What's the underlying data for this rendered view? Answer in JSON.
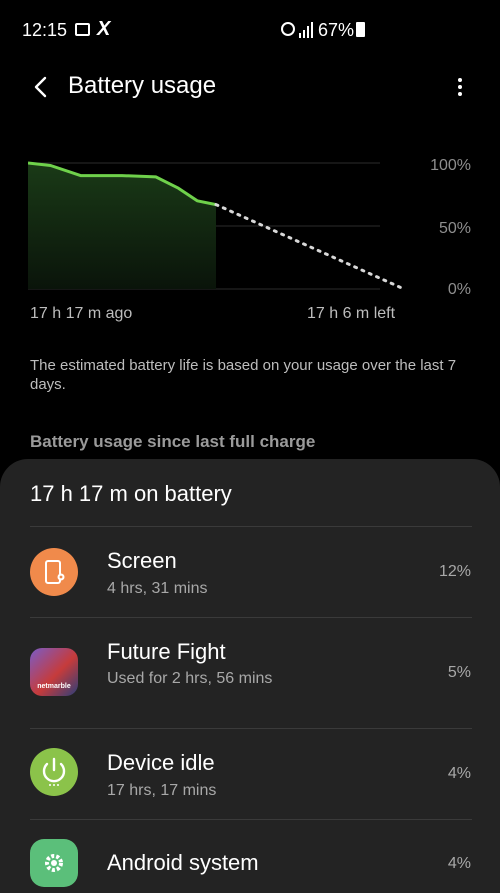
{
  "status_bar": {
    "time": "12:15",
    "battery_percent": "67%",
    "icons": [
      "gallery-icon",
      "x-app-icon",
      "alarm-icon",
      "signal-icon",
      "battery-icon"
    ]
  },
  "header": {
    "title": "Battery usage",
    "back_icon": "back-arrow-icon",
    "more_icon": "more-options-icon"
  },
  "chart": {
    "y_ticks": [
      "100%",
      "50%",
      "0%"
    ],
    "x_start_label": "17 h 17 m ago",
    "x_end_label": "17 h 6 m left"
  },
  "chart_data": {
    "type": "line",
    "ylim": [
      0,
      100
    ],
    "series": [
      {
        "x": [
          0,
          0.06,
          0.14,
          0.25,
          0.34,
          0.4,
          0.45,
          0.5
        ],
        "y": [
          100,
          98,
          90,
          90,
          89,
          80,
          70,
          67
        ]
      },
      {
        "x": [
          0.5,
          1.0
        ],
        "y": [
          67,
          0
        ]
      }
    ],
    "colors": {
      "actual": "#6fd14b",
      "projected": "#d8d8d8",
      "fill": "#1a3a17"
    }
  },
  "estimate_note": "The estimated battery life is based on your usage over the last 7 days.",
  "section_heading": "Battery usage since last full charge",
  "usage": {
    "on_battery": "17 h 17 m on battery",
    "items": [
      {
        "name": "Screen",
        "detail": "4 hrs, 31 mins",
        "percent": "12%",
        "icon": "screen-settings-icon",
        "color": "#f08a4b"
      },
      {
        "name": "Future Fight",
        "detail": "Used for 2 hrs, 56 mins",
        "percent": "5%",
        "icon": "future-fight-app-icon",
        "color": "#5a6fb0",
        "badge": "netmarble"
      },
      {
        "name": "Device idle",
        "detail": "17 hrs, 17 mins",
        "percent": "4%",
        "icon": "power-icon",
        "color": "#8bc34a"
      },
      {
        "name": "Android system",
        "detail": "",
        "percent": "4%",
        "icon": "android-settings-icon",
        "color": "#5bbf7a"
      }
    ]
  }
}
